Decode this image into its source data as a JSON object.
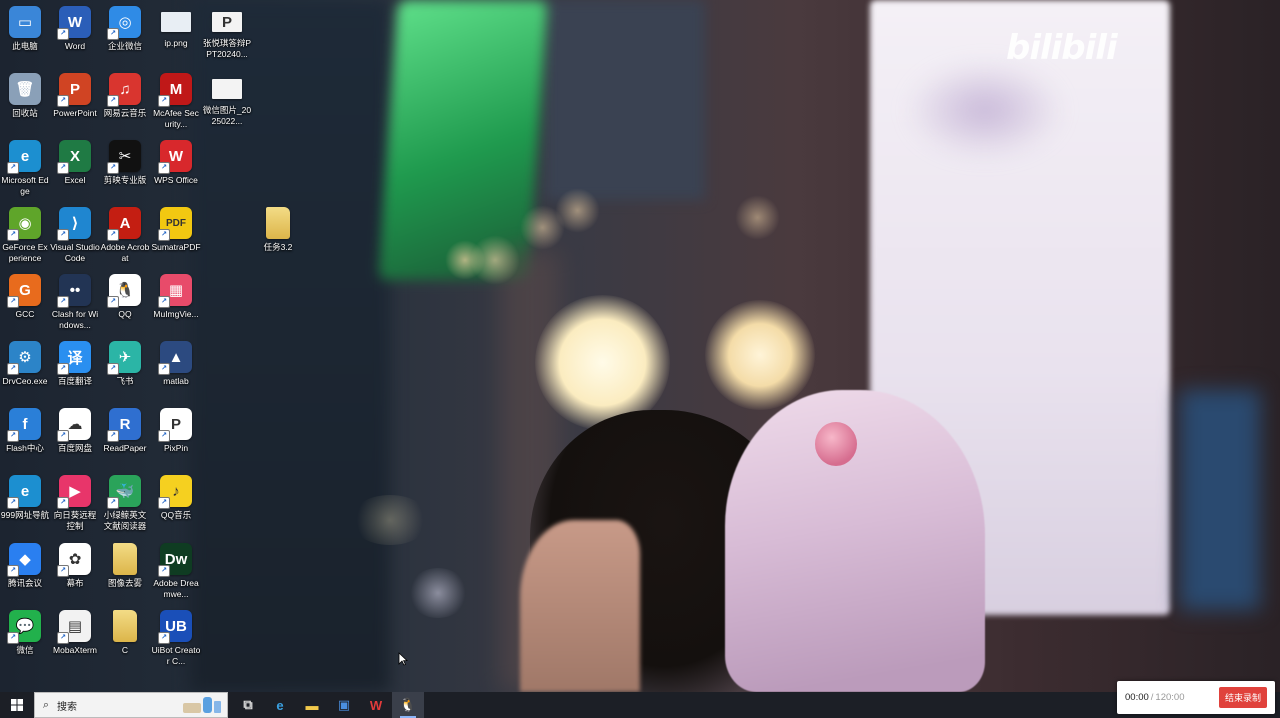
{
  "watermark": {
    "user_text": "",
    "logo_text": "bilibili"
  },
  "desktop_icons": [
    {
      "label": "此电脑",
      "icon": "this-pc-icon",
      "color": "#3a86d8",
      "glyph": "▭",
      "shortcut": false
    },
    {
      "label": "Word",
      "icon": "word-icon",
      "color": "#2b5eb8",
      "glyph": "W",
      "shortcut": true
    },
    {
      "label": "企业微信",
      "icon": "wecom-icon",
      "color": "#2f8be6",
      "glyph": "◎",
      "shortcut": true
    },
    {
      "label": "ip.png",
      "icon": "image-file-icon",
      "color": "#e8eef4",
      "glyph": "",
      "shortcut": false
    },
    {
      "label": "张悦琪答辩PPT20240...",
      "icon": "ppt-file-icon",
      "color": "#f3f3f3",
      "glyph": "P",
      "shortcut": false
    },
    {
      "label": "回收站",
      "icon": "recycle-bin-icon",
      "color": "#8aa0b8",
      "glyph": "🗑",
      "shortcut": false
    },
    {
      "label": "PowerPoint",
      "icon": "powerpoint-icon",
      "color": "#d04423",
      "glyph": "P",
      "shortcut": true
    },
    {
      "label": "网易云音乐",
      "icon": "netease-music-icon",
      "color": "#d9352f",
      "glyph": "♫",
      "shortcut": true
    },
    {
      "label": "McAfee Security...",
      "icon": "mcafee-icon",
      "color": "#c01818",
      "glyph": "M",
      "shortcut": true
    },
    {
      "label": "微信图片_2025022...",
      "icon": "image-file-icon",
      "color": "#f3f3f3",
      "glyph": "",
      "shortcut": false
    },
    {
      "label": "Microsoft Edge",
      "icon": "edge-icon",
      "color": "#1c8fd0",
      "glyph": "e",
      "shortcut": true
    },
    {
      "label": "Excel",
      "icon": "excel-icon",
      "color": "#1f7a44",
      "glyph": "X",
      "shortcut": true
    },
    {
      "label": "剪映专业版",
      "icon": "capcut-icon",
      "color": "#111111",
      "glyph": "✂",
      "shortcut": true
    },
    {
      "label": "WPS Office",
      "icon": "wps-icon",
      "color": "#d8282c",
      "glyph": "W",
      "shortcut": true
    },
    {
      "label": "GeForce Experience",
      "icon": "geforce-icon",
      "color": "#5fa52a",
      "glyph": "◉",
      "shortcut": true
    },
    {
      "label": "Visual Studio Code",
      "icon": "vscode-icon",
      "color": "#1f86d0",
      "glyph": "⟩",
      "shortcut": true
    },
    {
      "label": "Adobe Acrobat",
      "icon": "acrobat-icon",
      "color": "#c41e12",
      "glyph": "A",
      "shortcut": true
    },
    {
      "label": "SumatraPDF",
      "icon": "sumatra-icon",
      "color": "#f2c811",
      "glyph": "PDF",
      "shortcut": true
    },
    {
      "label": "任务3.2",
      "icon": "folder-icon",
      "color": "#e7c85c",
      "glyph": "",
      "shortcut": false
    },
    {
      "label": "GCC",
      "icon": "gcc-icon",
      "color": "#e86b1d",
      "glyph": "G",
      "shortcut": true
    },
    {
      "label": "Clash for Windows...",
      "icon": "clash-icon",
      "color": "#223454",
      "glyph": "••",
      "shortcut": true
    },
    {
      "label": "QQ",
      "icon": "qq-icon",
      "color": "#ffffff",
      "glyph": "🐧",
      "shortcut": true
    },
    {
      "label": "MuImgVie...",
      "icon": "muimg-icon",
      "color": "#e84b6a",
      "glyph": "▦",
      "shortcut": true
    },
    {
      "label": "DrvCeo.exe",
      "icon": "drvceo-icon",
      "color": "#2c84c8",
      "glyph": "⚙",
      "shortcut": true
    },
    {
      "label": "百度翻译",
      "icon": "baidu-translate-icon",
      "color": "#2a8ff0",
      "glyph": "译",
      "shortcut": true
    },
    {
      "label": "飞书",
      "icon": "feishu-icon",
      "color": "#2bb5a6",
      "glyph": "✈",
      "shortcut": true
    },
    {
      "label": "matlab",
      "icon": "matlab-icon",
      "color": "#2c4a80",
      "glyph": "▲",
      "shortcut": true
    },
    {
      "label": "Flash中心",
      "icon": "flash-icon",
      "color": "#2a7fd8",
      "glyph": "f",
      "shortcut": true
    },
    {
      "label": "百度网盘",
      "icon": "baidu-netdisk-icon",
      "color": "#ffffff",
      "glyph": "☁",
      "shortcut": true
    },
    {
      "label": "ReadPaper",
      "icon": "readpaper-icon",
      "color": "#2f6fd0",
      "glyph": "R",
      "shortcut": true
    },
    {
      "label": "PixPin",
      "icon": "pixpin-icon",
      "color": "#ffffff",
      "glyph": "P",
      "shortcut": true
    },
    {
      "label": "999网址导航",
      "icon": "edge-icon",
      "color": "#1c8fd0",
      "glyph": "e",
      "shortcut": true
    },
    {
      "label": "向日葵远程控制",
      "icon": "sunlogin-icon",
      "color": "#e8356a",
      "glyph": "▶",
      "shortcut": true
    },
    {
      "label": "小绿鲸英文文献阅读器",
      "icon": "whale-icon",
      "color": "#2aa35a",
      "glyph": "🐳",
      "shortcut": true
    },
    {
      "label": "QQ音乐",
      "icon": "qqmusic-icon",
      "color": "#f5d020",
      "glyph": "♪",
      "shortcut": true
    },
    {
      "label": "腾讯会议",
      "icon": "tencent-meeting-icon",
      "color": "#2a7ff0",
      "glyph": "◆",
      "shortcut": true
    },
    {
      "label": "幕布",
      "icon": "mubu-icon",
      "color": "#ffffff",
      "glyph": "✿",
      "shortcut": true
    },
    {
      "label": "图像去雾",
      "icon": "folder-icon",
      "color": "#e7c85c",
      "glyph": "",
      "shortcut": false
    },
    {
      "label": "Adobe Dreamwe...",
      "icon": "dreamweaver-icon",
      "color": "#0f3c22",
      "glyph": "Dw",
      "shortcut": true
    },
    {
      "label": "微信",
      "icon": "wechat-icon",
      "color": "#22b14c",
      "glyph": "💬",
      "shortcut": true
    },
    {
      "label": "MobaXterm",
      "icon": "mobaxterm-icon",
      "color": "#f2f2f2",
      "glyph": "▤",
      "shortcut": true
    },
    {
      "label": "C",
      "icon": "folder-icon",
      "color": "#e7c85c",
      "glyph": "",
      "shortcut": false
    },
    {
      "label": "UiBot Creator C...",
      "icon": "uibot-icon",
      "color": "#1a4fb8",
      "glyph": "UB",
      "shortcut": true
    }
  ],
  "taskbar": {
    "search_placeholder": "搜索",
    "apps": [
      {
        "name": "task-view-icon",
        "glyph": "⧉",
        "active": false
      },
      {
        "name": "edge-taskbar-icon",
        "glyph": "e",
        "active": false
      },
      {
        "name": "file-explorer-icon",
        "glyph": "▬",
        "active": false
      },
      {
        "name": "store-icon",
        "glyph": "▣",
        "active": false
      },
      {
        "name": "wps-taskbar-icon",
        "glyph": "W",
        "active": false
      },
      {
        "name": "qq-taskbar-icon",
        "glyph": "🐧",
        "active": true
      }
    ]
  },
  "recorder": {
    "current_time": "00:00",
    "separator": "/",
    "max_time": "120:00",
    "stop_label": "结束录制"
  }
}
